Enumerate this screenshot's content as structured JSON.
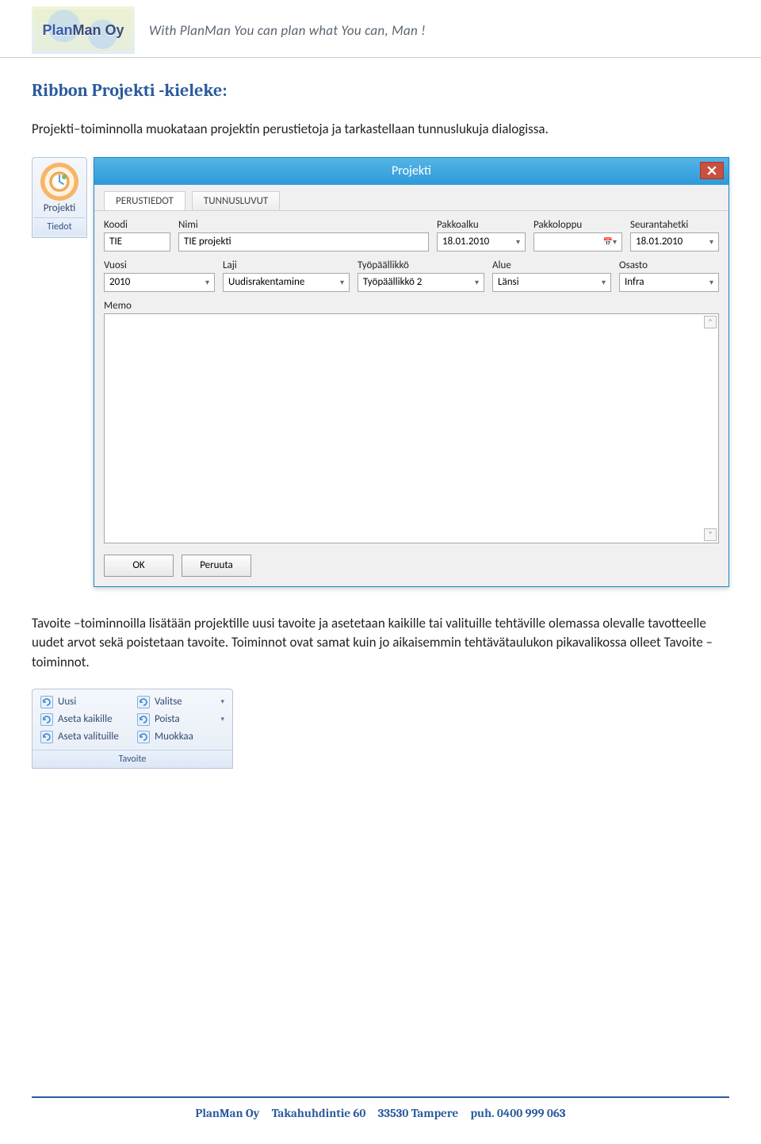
{
  "header": {
    "logo_text": "PlanMan Oy",
    "slogan": "With PlanMan You can plan what You can, Man !"
  },
  "section_title": "Ribbon Projekti -kieleke:",
  "paragraph1": "Projekti–toiminnolla muokataan projektin perustietoja ja tarkastellaan tunnuslukuja dialogissa.",
  "ribbon_projekti": {
    "big_button_label": "Projekti",
    "group_label": "Tiedot"
  },
  "dialog": {
    "title": "Projekti",
    "tabs": [
      "PERUSTIEDOT",
      "TUNNUSLUVUT"
    ],
    "row1": {
      "koodi": {
        "label": "Koodi",
        "value": "TIE"
      },
      "nimi": {
        "label": "Nimi",
        "value": "TIE projekti"
      },
      "pakkoalku": {
        "label": "Pakkoalku",
        "value": "18.01.2010"
      },
      "pakkoloppu": {
        "label": "Pakkoloppu",
        "value": ""
      },
      "seurantahetki": {
        "label": "Seurantahetki",
        "value": "18.01.2010"
      }
    },
    "row2": {
      "vuosi": {
        "label": "Vuosi",
        "value": "2010"
      },
      "laji": {
        "label": "Laji",
        "value": "Uudisrakentamine"
      },
      "tyopaallikko": {
        "label": "Työpäällikkö",
        "value": "Työpäällikkö 2"
      },
      "alue": {
        "label": "Alue",
        "value": "Länsi"
      },
      "osasto": {
        "label": "Osasto",
        "value": "Infra"
      }
    },
    "memo_label": "Memo",
    "buttons": {
      "ok": "OK",
      "cancel": "Peruuta"
    }
  },
  "paragraph2": "Tavoite –toiminnoilla lisätään projektille uusi tavoite ja asetetaan kaikille tai valituille tehtäville olemassa olevalle tavotteelle uudet arvot sekä poistetaan tavoite. Toiminnot ovat samat kuin jo aikaisemmin tehtävätaulukon pikavalikossa olleet Tavoite –toiminnot.",
  "tavoite_group": {
    "items": [
      {
        "label": "Uusi",
        "dropdown": false
      },
      {
        "label": "Valitse",
        "dropdown": true
      },
      {
        "label": "Aseta kaikille",
        "dropdown": false
      },
      {
        "label": "Poista",
        "dropdown": true
      },
      {
        "label": "Aseta valituille",
        "dropdown": false
      },
      {
        "label": "Muokkaa",
        "dropdown": false
      }
    ],
    "footer": "Tavoite"
  },
  "footer": {
    "company": "PlanMan Oy",
    "address": "Takahuhdintie 60",
    "postal": "33530 Tampere",
    "phone": "puh. 0400 999 063"
  }
}
